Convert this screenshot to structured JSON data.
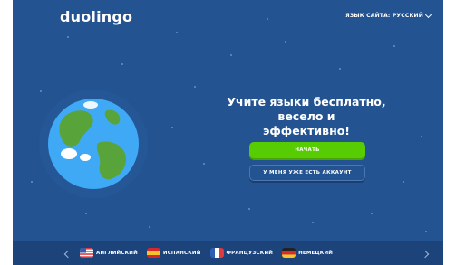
{
  "header": {
    "logo": "duolingo",
    "site_language_label": "ЯЗЫК САЙТА: РУССКИЙ"
  },
  "hero": {
    "headline_line1": "Учите языки бесплатно, весело и",
    "headline_line2": "эффективно!",
    "start_button": "НАЧАТЬ",
    "account_button": "У МЕНЯ УЖЕ ЕСТЬ АККАУНТ"
  },
  "footer": {
    "languages": [
      {
        "label": "АНГЛИЙСКИЙ",
        "flag": "us-flag-icon"
      },
      {
        "label": "ИСПАНСКИЙ",
        "flag": "spain-flag-icon"
      },
      {
        "label": "ФРАНЦУЗСКИЙ",
        "flag": "france-flag-icon"
      },
      {
        "label": "НЕМЕЦКИЙ",
        "flag": "germany-flag-icon"
      }
    ]
  },
  "colors": {
    "background": "#235390",
    "accent_green": "#58cc02",
    "footer": "#1c437a"
  }
}
